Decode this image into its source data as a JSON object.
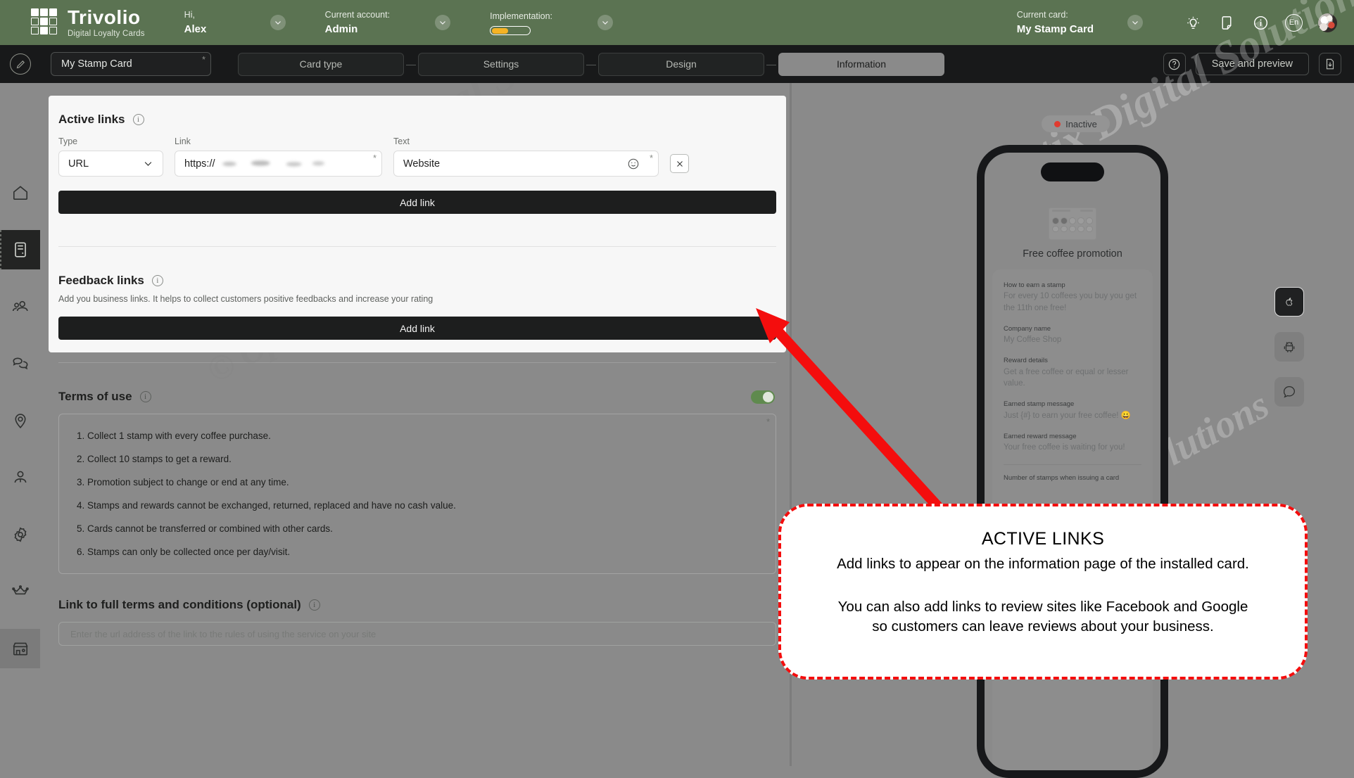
{
  "brand": {
    "name": "Trivolio",
    "tagline": "Digital Loyalty Cards",
    "accent_green": "#5b7352",
    "accent_yellow": "#f5b324",
    "alert_red": "#f40d0d"
  },
  "header": {
    "greeting_label": "Hi,",
    "greeting_value": "Alex",
    "account_label": "Current account:",
    "account_value": "Admin",
    "implementation_label": "Implementation:",
    "implementation_percent": 45,
    "card_label": "Current card:",
    "card_value": "My Stamp Card",
    "language": "En",
    "icons": [
      "bulb-icon",
      "mobile-card-icon",
      "info-icon",
      "language-icon",
      "avatar"
    ]
  },
  "subheader": {
    "card_name_value": "My Stamp Card",
    "steps": [
      {
        "label": "Card type",
        "active": false
      },
      {
        "label": "Settings",
        "active": false
      },
      {
        "label": "Design",
        "active": false
      },
      {
        "label": "Information",
        "active": true
      }
    ],
    "step_separator": "—",
    "help_label": "?",
    "save_label": "Save and preview",
    "download_icon": "download-file-icon",
    "edit_icon": "pencil-icon"
  },
  "sidebar": {
    "items": [
      {
        "name": "home",
        "icon": "home-icon",
        "active": false
      },
      {
        "name": "cards",
        "icon": "loyalty-card-icon",
        "active": true
      },
      {
        "name": "clients",
        "icon": "users-icon",
        "active": false
      },
      {
        "name": "messages",
        "icon": "chat-bubbles-icon",
        "active": false
      },
      {
        "name": "locations",
        "icon": "location-pin-icon",
        "active": false
      },
      {
        "name": "staff",
        "icon": "person-icon",
        "active": false
      },
      {
        "name": "settings",
        "icon": "gear-icon",
        "active": false
      },
      {
        "name": "subscription",
        "icon": "crown-icon",
        "active": false
      },
      {
        "name": "business",
        "icon": "storefront-icon",
        "active": false
      }
    ]
  },
  "active_links": {
    "title": "Active links",
    "col_type": "Type",
    "col_link": "Link",
    "col_text": "Text",
    "rows": [
      {
        "type": "URL",
        "link_prefix": "https://",
        "link_value_redacted": true,
        "text": "Website",
        "emoji_icon": "emoji-smiley-icon",
        "remove_icon": "close-icon"
      }
    ],
    "add_link_label": "Add link",
    "required_marker": "*"
  },
  "feedback_links": {
    "title": "Feedback links",
    "description": "Add you business links. It helps to collect customers positive feedbacks and increase your rating",
    "add_link_label": "Add link"
  },
  "terms_of_use": {
    "title": "Terms of use",
    "enabled": true,
    "required_marker": "*",
    "items": [
      "Collect 1 stamp with every coffee purchase.",
      "Collect 10 stamps to get a reward.",
      "Promotion subject to change or end at any time.",
      "Stamps and rewards cannot be exchanged, returned, replaced and have no cash value.",
      "Cards cannot be transferred or combined with other cards.",
      "Stamps can only be collected once per day/visit."
    ]
  },
  "terms_link": {
    "title": "Link to full terms and conditions (optional)",
    "placeholder": "Enter the url address of the link to the rules of using the service on your site",
    "value": ""
  },
  "preview": {
    "status": "Inactive",
    "status_color": "#e03b2f",
    "promo_title": "Free coffee promotion",
    "platforms": [
      {
        "name": "apple-wallet",
        "icon": "apple-icon",
        "selected": true
      },
      {
        "name": "android-google-wallet",
        "icon": "android-icon",
        "selected": false
      },
      {
        "name": "chat-preview",
        "icon": "chat-bubble-icon",
        "selected": false
      }
    ],
    "sections": [
      {
        "label": "How to earn a stamp",
        "value": "For every 10 coffees you buy you get the 11th one free!"
      },
      {
        "label": "Company name",
        "value": "My Coffee Shop"
      },
      {
        "label": "Reward details",
        "value": "Get a free coffee or equal or lesser value."
      },
      {
        "label": "Earned stamp message",
        "value": "Just {#} to earn your free coffee! 😀"
      },
      {
        "label": "Earned reward message",
        "value": "Your free coffee is waiting for you!"
      }
    ],
    "footer_label": "Number of stamps when issuing a card"
  },
  "callout": {
    "title": "ACTIVE LINKS",
    "line1": "Add links to appear on the information page of the installed card.",
    "line2": "You can also add links to review sites like Facebook and Google",
    "line3": "so customers can leave reviews about your business."
  },
  "watermarks": [
    "© Optix Digital Solutions",
    "Optix Digital Solutions",
    "© Optix Digital Solutions"
  ]
}
